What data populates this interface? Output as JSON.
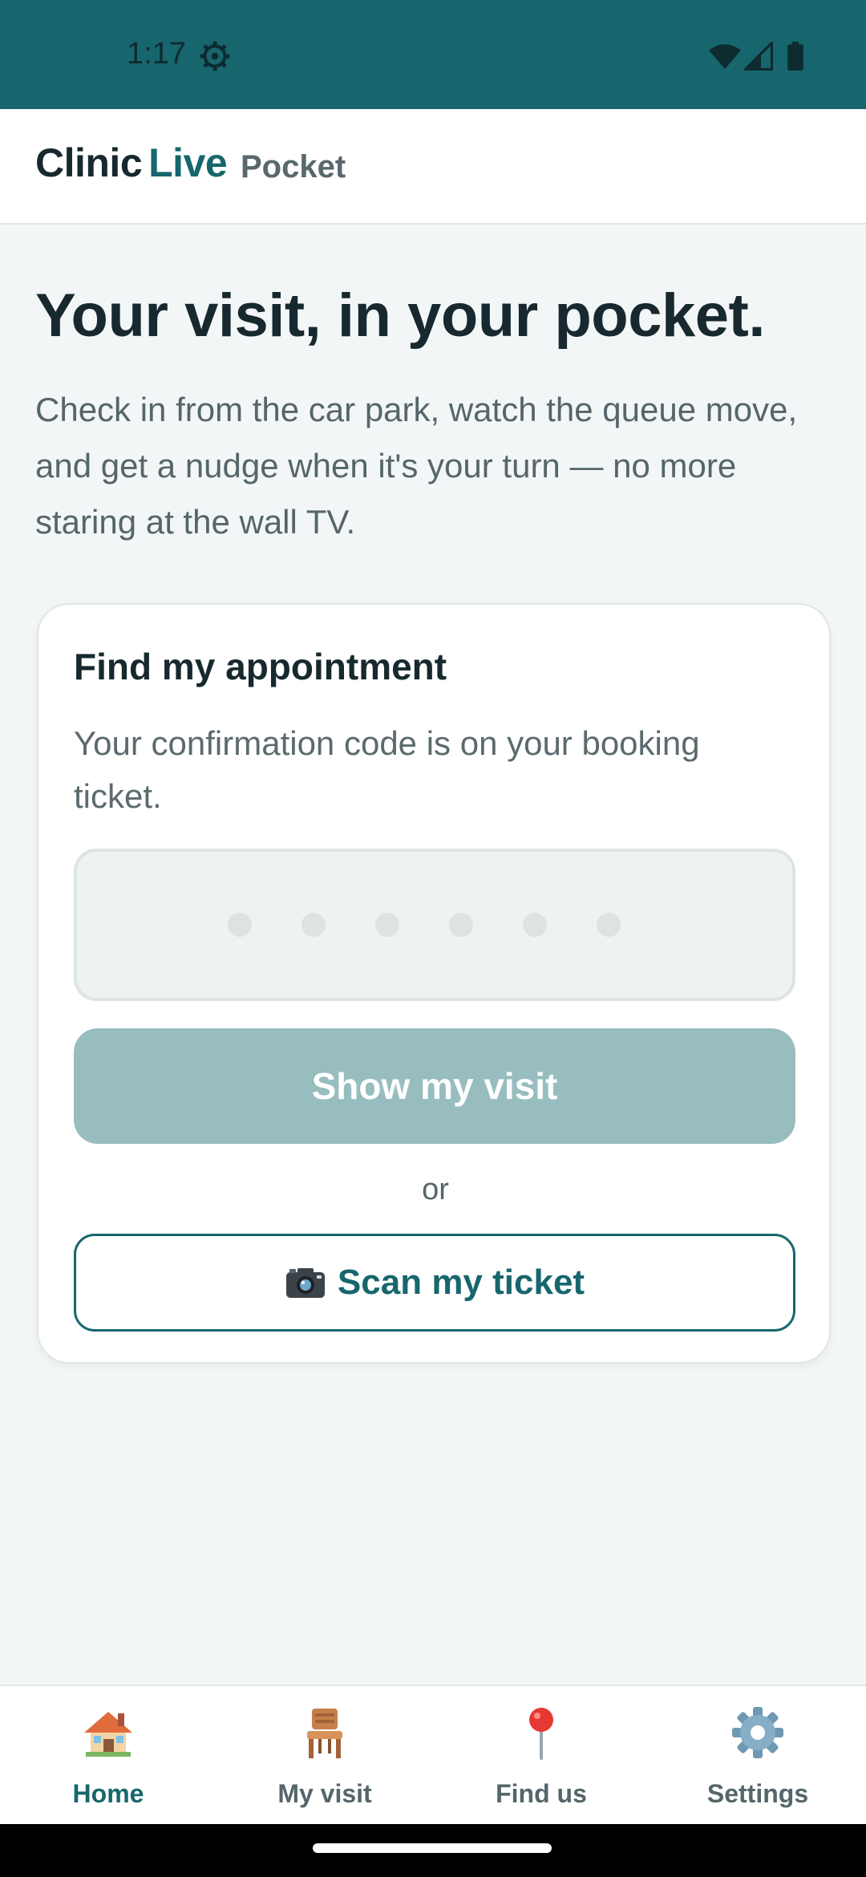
{
  "status_bar": {
    "time": "1:17"
  },
  "header": {
    "brand_first": "Clinic",
    "brand_second": "Live",
    "subtitle": "Pocket"
  },
  "hero": {
    "title": "Your visit, in your pocket.",
    "body": "Check in from the car park, watch the queue move, and get a nudge when it's your turn — no more staring at the wall TV."
  },
  "card": {
    "title": "Find my appointment",
    "description": "Your confirmation code is on your booking ticket.",
    "code_placeholder_digits": 6,
    "show_button": "Show my visit",
    "or_text": "or",
    "scan_button": "Scan my ticket"
  },
  "nav": {
    "items": [
      {
        "label": "Home",
        "icon": "house-icon",
        "active": true
      },
      {
        "label": "My visit",
        "icon": "chair-icon",
        "active": false
      },
      {
        "label": "Find us",
        "icon": "map-pin-icon",
        "active": false
      },
      {
        "label": "Settings",
        "icon": "gear-icon",
        "active": false
      }
    ]
  },
  "colors": {
    "brand": "#17666d",
    "disabled_button": "#97bdbf",
    "text_dark": "#17292e",
    "text_muted": "#55666a"
  }
}
